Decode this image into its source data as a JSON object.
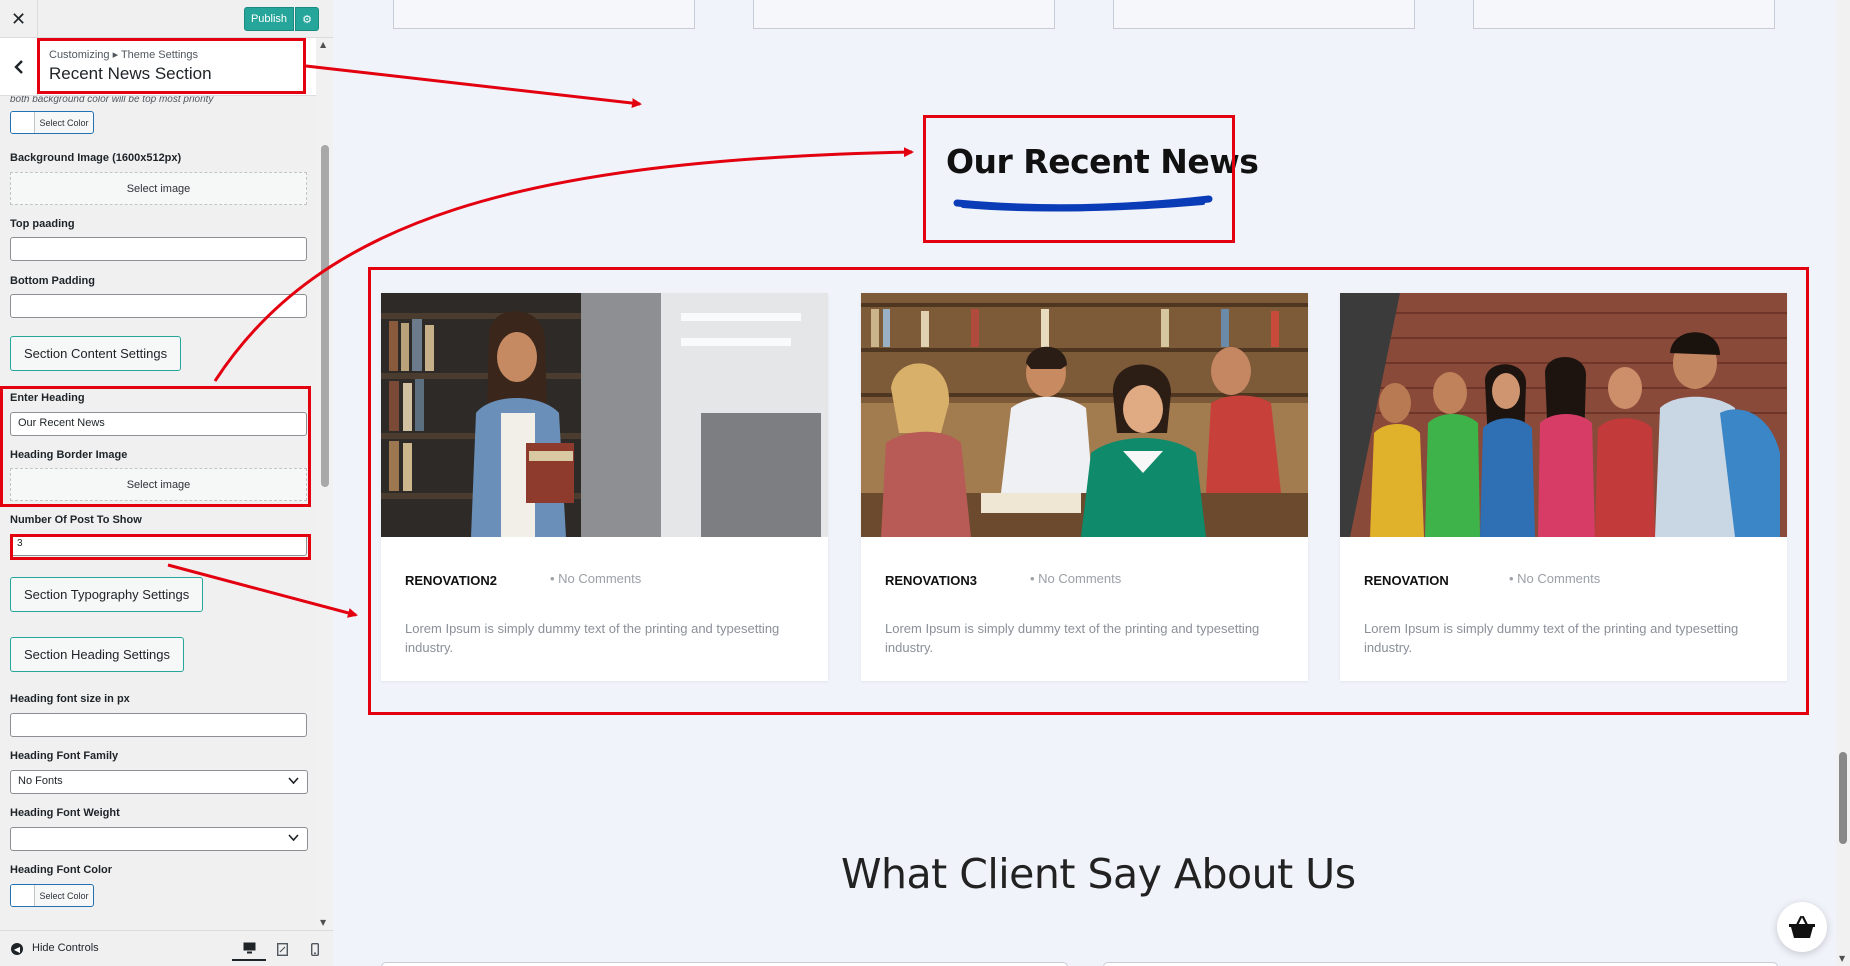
{
  "topbar": {
    "close_label": "✕",
    "publish_label": "Publish",
    "gear_label": "⚙"
  },
  "panel": {
    "breadcrumb": "Customizing ▸ Theme Settings",
    "title": "Recent News Section",
    "back_label": "‹"
  },
  "fields": {
    "priority_note": "both background color will be top most priority",
    "select_color": "Select Color",
    "bg_image_label": "Background Image (1600x512px)",
    "select_image": "Select image",
    "top_padding_label": "Top paading",
    "top_padding_value": "",
    "bottom_padding_label": "Bottom Padding",
    "bottom_padding_value": "",
    "content_settings_btn": "Section Content Settings",
    "enter_heading_label": "Enter Heading",
    "enter_heading_value": "Our Recent News",
    "heading_border_label": "Heading Border Image",
    "num_posts_label": "Number Of Post To Show",
    "num_posts_value": "3",
    "typography_btn": "Section Typography Settings",
    "heading_settings_btn": "Section Heading Settings",
    "heading_font_size_label": "Heading font size in px",
    "heading_font_size_value": "",
    "heading_font_family_label": "Heading Font Family",
    "heading_font_family_value": "No Fonts",
    "heading_font_weight_label": "Heading Font Weight",
    "heading_font_weight_value": "",
    "heading_font_color_label": "Heading Font Color"
  },
  "footer": {
    "hide_controls": "Hide Controls"
  },
  "preview": {
    "news_heading": "Our Recent News",
    "cards": [
      {
        "title": "RENOVATION2",
        "meta": "• No Comments",
        "text": "Lorem Ipsum is simply dummy text of the printing and typesetting industry."
      },
      {
        "title": "RENOVATION3",
        "meta": "• No Comments",
        "text": "Lorem Ipsum is simply dummy text of the printing and typesetting industry."
      },
      {
        "title": "RENOVATION",
        "meta": "• No Comments",
        "text": "Lorem Ipsum is simply dummy text of the printing and typesetting industry."
      }
    ],
    "client_heading": "What Client Say About Us"
  },
  "colors": {
    "accent": "#26a69a",
    "annotation": "#e3000f",
    "underline": "#0b3cb8"
  }
}
